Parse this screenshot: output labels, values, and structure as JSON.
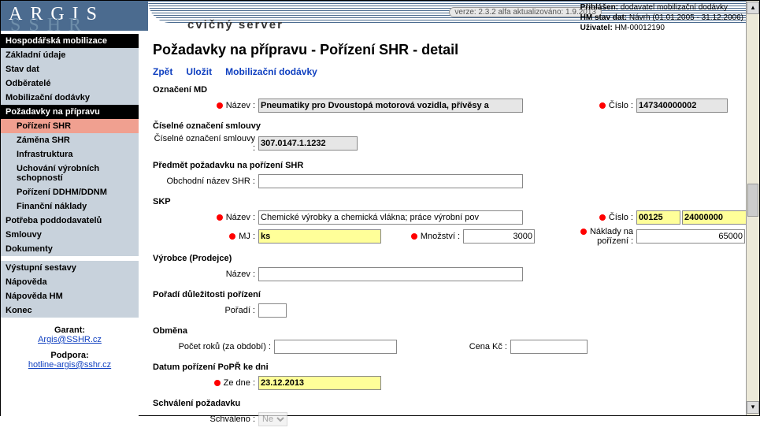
{
  "app": {
    "logo": "ARGIS",
    "shadow": "SSHR",
    "server": "cvičný server",
    "version": "verze: 2.3.2 alfa aktualizováno: 1.9.2013"
  },
  "login": {
    "l1a": "Přihlášen:",
    "l1b": "dodavatel mobilizační dodávky",
    "l2a": "HM stav dat:",
    "l2b": "Návrh (01.01.2005 - 31.12.2006)",
    "l3a": "Uživatel:",
    "l3b": "HM-00012190"
  },
  "nav": {
    "g1": "Hospodářská mobilizace",
    "i1": "Základní údaje",
    "i2": "Stav dat",
    "i3": "Odběratelé",
    "i4": "Mobilizační dodávky",
    "g2": "Požadavky na přípravu",
    "s1": "Pořízení SHR",
    "s2": "Záměna SHR",
    "s3": "Infrastruktura",
    "s4": "Uchování výrobních schopností",
    "s5": "Pořízení DDHM/DDNM",
    "s6": "Finanční náklady",
    "i5": "Potřeba poddodavatelů",
    "i6": "Smlouvy",
    "i7": "Dokumenty",
    "i8": "Výstupní sestavy",
    "i9": "Nápověda",
    "i10": "Nápověda HM",
    "i11": "Konec",
    "garant_l": "Garant:",
    "garant": "Argis@SSHR.cz",
    "podpora_l": "Podpora:",
    "podpora": "hotline-argis@sshr.cz"
  },
  "page": {
    "title": "Požadavky na přípravu - Pořízení SHR - detail",
    "act": {
      "back": "Zpět",
      "save": "Uložit",
      "md": "Mobilizační dodávky"
    },
    "s_md": "Označení MD",
    "md_name_l": "Název :",
    "md_name": "Pneumatiky pro Dvoustopá motorová vozidla, přívěsy a",
    "md_num_l": "Číslo :",
    "md_num": "147340000002",
    "s_con": "Číselné označení smlouvy",
    "con_l": "Číselné označení smlouvy :",
    "con": "307.0147.1.1232",
    "s_sub": "Předmět požadavku na pořízení SHR",
    "trade_l": "Obchodní název SHR :",
    "trade": "",
    "s_skp": "SKP",
    "skp_name_l": "Název :",
    "skp_name": "Chemické výrobky a chemická vlákna; práce výrobní pov",
    "skp_num_l": "Číslo :",
    "skp_num1": "00125",
    "skp_num2": "24000000",
    "mj_l": "MJ :",
    "mj": "ks",
    "qty_l": "Množství :",
    "qty": "3000",
    "cost_l": "Náklady na pořízení :",
    "cost": "65000",
    "s_mfr": "Výrobce (Prodejce)",
    "mfr_l": "Název :",
    "mfr": "",
    "s_prio": "Pořadí důležitosti pořízení",
    "prio_l": "Pořadí :",
    "prio": "",
    "s_obm": "Obměna",
    "years_l": "Počet roků (za období) :",
    "years": "",
    "price_l": "Cena Kč :",
    "price": "",
    "s_date": "Datum pořízení PoPŘ ke dni",
    "date_l": "Ze dne :",
    "date": "23.12.2013",
    "s_appr": "Schválení požadavku",
    "appr_l": "Schváleno :",
    "appr": "Ne"
  }
}
